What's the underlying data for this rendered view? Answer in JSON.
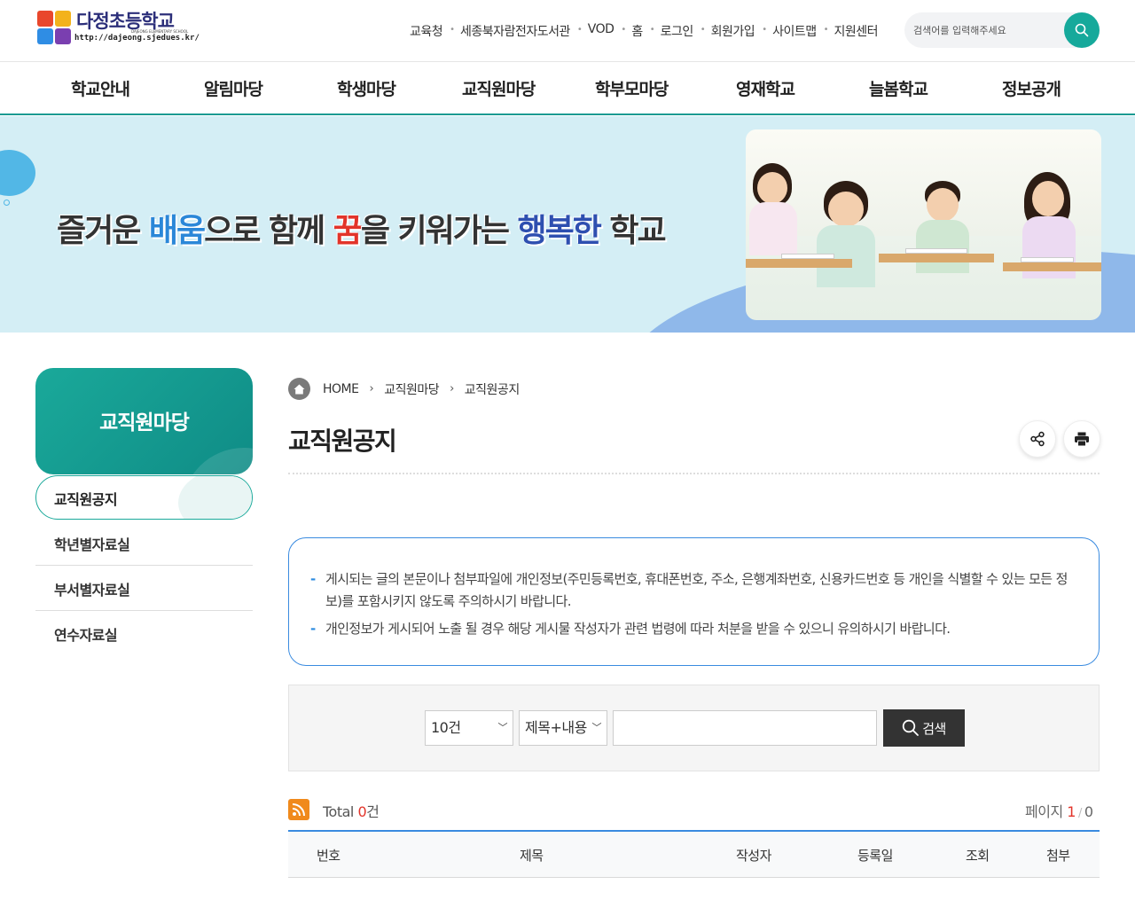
{
  "site": {
    "logo_title": "다정초등학교",
    "logo_sub": "DAJEONG ELEMENTARY SCHOOL",
    "logo_url": "http://dajeong.sjedues.kr/"
  },
  "util_links": [
    "교육청",
    "세종북자람전자도서관",
    "VOD",
    "홈",
    "로그인",
    "회원가입",
    "사이트맵",
    "지원센터"
  ],
  "search": {
    "placeholder": "검색어를 입력해주세요"
  },
  "gnb": [
    "학교안내",
    "알림마당",
    "학생마당",
    "교직원마당",
    "학부모마당",
    "영재학교",
    "늘봄학교",
    "정보공개"
  ],
  "banner": {
    "slogan_parts": [
      "즐거운 ",
      "배움",
      "으로 함께 ",
      "꿈",
      "을 키워가는 ",
      "행복한",
      " 학교"
    ]
  },
  "lnb": {
    "title": "교직원마당",
    "active": "교직원공지",
    "items": [
      "학년별자료실",
      "부서별자료실",
      "연수자료실"
    ]
  },
  "breadcrumb": [
    "HOME",
    "교직원마당",
    "교직원공지"
  ],
  "page_title": "교직원공지",
  "icons": [
    "home-icon",
    "share-icon",
    "print-icon",
    "search-icon",
    "rss-icon",
    "chevron-down-icon"
  ],
  "notice": [
    "게시되는 글의 본문이나 첨부파일에 개인정보(주민등록번호, 휴대폰번호, 주소, 은행계좌번호, 신용카드번호 등 개인을 식별할 수 있는 모든 정보)를 포함시키지 않도록 주의하시기 바랍니다.",
    "개인정보가 게시되어 노출 될 경우 해당 게시물 작성자가 관련 법령에 따라 처분을 받을 수 있으니 유의하시기 바랍니다."
  ],
  "board_search": {
    "count_select": "10건",
    "field_select": "제목+내용",
    "keyword": "",
    "button": "검색"
  },
  "board_info": {
    "total_label": "Total ",
    "total_count": "0",
    "total_unit": "건",
    "page_label": "페이지 ",
    "page_current": "1",
    "page_total": "0"
  },
  "table_headers": [
    "번호",
    "제목",
    "작성자",
    "등록일",
    "조회",
    "첨부"
  ],
  "colors": {
    "brand": "#1aa99a",
    "accent_blue": "#3a8be0",
    "highlight_red": "#e2342a",
    "banner_bg": "#d4eef5"
  }
}
